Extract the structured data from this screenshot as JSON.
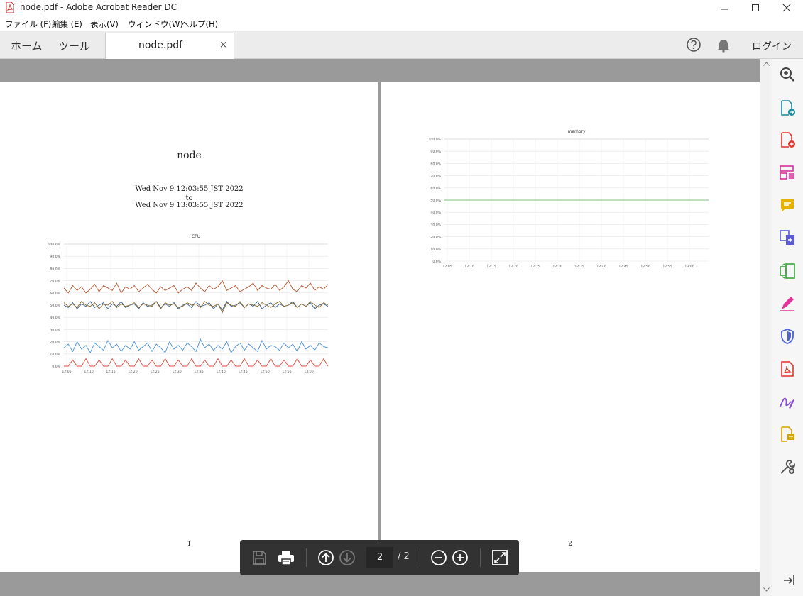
{
  "window": {
    "title": "node.pdf - Adobe Acrobat Reader DC"
  },
  "menu": [
    "ファイル (F)",
    "編集 (E)",
    "表示(V)",
    "ウィンドウ(W)",
    "ヘルプ(H)"
  ],
  "tabs": {
    "home": "ホーム",
    "tools": "ツール",
    "document": "node.pdf",
    "close": "×"
  },
  "header_right": {
    "login": "ログイン"
  },
  "page1": {
    "title": "node",
    "date_from": "Wed Nov 9 12:03:55 JST 2022",
    "to": "to",
    "date_to": "Wed Nov 9 13:03:55 JST 2022",
    "page_number": "1"
  },
  "page2": {
    "page_number": "2"
  },
  "toolbar": {
    "current_page": "2",
    "total_pages": "/ 2"
  },
  "chart_data": [
    {
      "type": "line",
      "title": "CPU",
      "x": [
        "12:05",
        "12:10",
        "12:15",
        "12:20",
        "12:25",
        "12:30",
        "12:35",
        "12:40",
        "12:45",
        "12:50",
        "12:55",
        "13:00"
      ],
      "y_ticks": [
        "0.0%",
        "10.0%",
        "20.0%",
        "30.0%",
        "40.0%",
        "50.0%",
        "60.0%",
        "70.0%",
        "80.0%",
        "90.0%",
        "100.0%"
      ],
      "ylim": [
        0,
        100
      ],
      "series": [
        {
          "color": "#b5532c",
          "values": [
            64,
            60,
            66,
            62,
            65,
            60,
            63,
            67,
            61,
            66,
            64,
            62,
            68,
            60,
            65,
            63,
            66,
            61,
            64,
            67,
            63,
            60,
            65,
            62,
            64,
            66,
            60,
            63,
            65,
            62,
            68,
            64,
            61,
            66,
            63,
            65,
            70,
            62,
            64,
            66,
            61,
            63,
            65,
            68,
            62,
            66,
            64,
            63,
            67,
            62,
            65,
            70,
            63,
            61,
            66,
            64,
            68,
            62,
            65,
            63,
            67
          ]
        },
        {
          "color": "#3a5f8a",
          "values": [
            50,
            48,
            52,
            47,
            51,
            49,
            53,
            48,
            50,
            52,
            47,
            51,
            49,
            53,
            48,
            50,
            51,
            47,
            52,
            49,
            50,
            53,
            48,
            51,
            49,
            52,
            47,
            50,
            51,
            48,
            53,
            49,
            50,
            52,
            47,
            51,
            46,
            53,
            49,
            50,
            52,
            48,
            51,
            49,
            53,
            47,
            50,
            52,
            48,
            51,
            49,
            50,
            53,
            48,
            51,
            49,
            52,
            47,
            50,
            51,
            49
          ]
        },
        {
          "color": "#8b6a2e",
          "values": [
            52,
            49,
            51,
            48,
            53,
            50,
            49,
            52,
            47,
            51,
            50,
            53,
            48,
            51,
            49,
            50,
            52,
            48,
            51,
            50,
            49,
            53,
            47,
            52,
            50,
            51,
            48,
            49,
            52,
            50,
            51,
            48,
            53,
            50,
            49,
            51,
            44,
            52,
            50,
            49,
            53,
            48,
            51,
            50,
            49,
            52,
            50,
            48,
            51,
            53,
            49,
            50,
            52,
            48,
            51,
            49,
            53,
            50,
            48,
            52,
            50
          ]
        },
        {
          "color": "#4a90d9",
          "values": [
            15,
            18,
            12,
            20,
            14,
            17,
            11,
            19,
            16,
            13,
            21,
            15,
            18,
            12,
            17,
            14,
            20,
            13,
            16,
            19,
            12,
            18,
            15,
            11,
            20,
            14,
            17,
            13,
            19,
            16,
            12,
            22,
            15,
            18,
            13,
            17,
            14,
            20,
            11,
            16,
            19,
            13,
            18,
            15,
            12,
            21,
            14,
            17,
            16,
            13,
            19,
            15,
            18,
            12,
            20,
            14,
            17,
            13,
            19,
            16,
            15
          ]
        },
        {
          "color": "#e0483b",
          "values": [
            0,
            0,
            5,
            0,
            0,
            6,
            0,
            0,
            5,
            0,
            0,
            6,
            0,
            0,
            5,
            0,
            0,
            6,
            0,
            0,
            5,
            0,
            0,
            6,
            0,
            0,
            5,
            0,
            0,
            6,
            0,
            0,
            5,
            0,
            0,
            6,
            0,
            0,
            5,
            0,
            0,
            6,
            0,
            0,
            5,
            0,
            0,
            6,
            0,
            0,
            5,
            0,
            0,
            6,
            0,
            0,
            5,
            0,
            0,
            6,
            0
          ]
        }
      ]
    },
    {
      "type": "line",
      "title": "memory",
      "x": [
        "12:05",
        "12:10",
        "12:15",
        "12:20",
        "12:25",
        "12:30",
        "12:35",
        "12:40",
        "12:45",
        "12:50",
        "12:55",
        "13:00"
      ],
      "y_ticks": [
        "0.0%",
        "10.0%",
        "20.0%",
        "30.0%",
        "40.0%",
        "50.0%",
        "60.0%",
        "70.0%",
        "80.0%",
        "90.0%",
        "100.0%"
      ],
      "ylim": [
        0,
        100
      ],
      "series": [
        {
          "color": "#7fbf7f",
          "values": [
            50,
            50,
            50,
            50,
            50,
            50,
            50,
            50,
            50,
            50,
            50,
            50
          ]
        }
      ]
    }
  ]
}
